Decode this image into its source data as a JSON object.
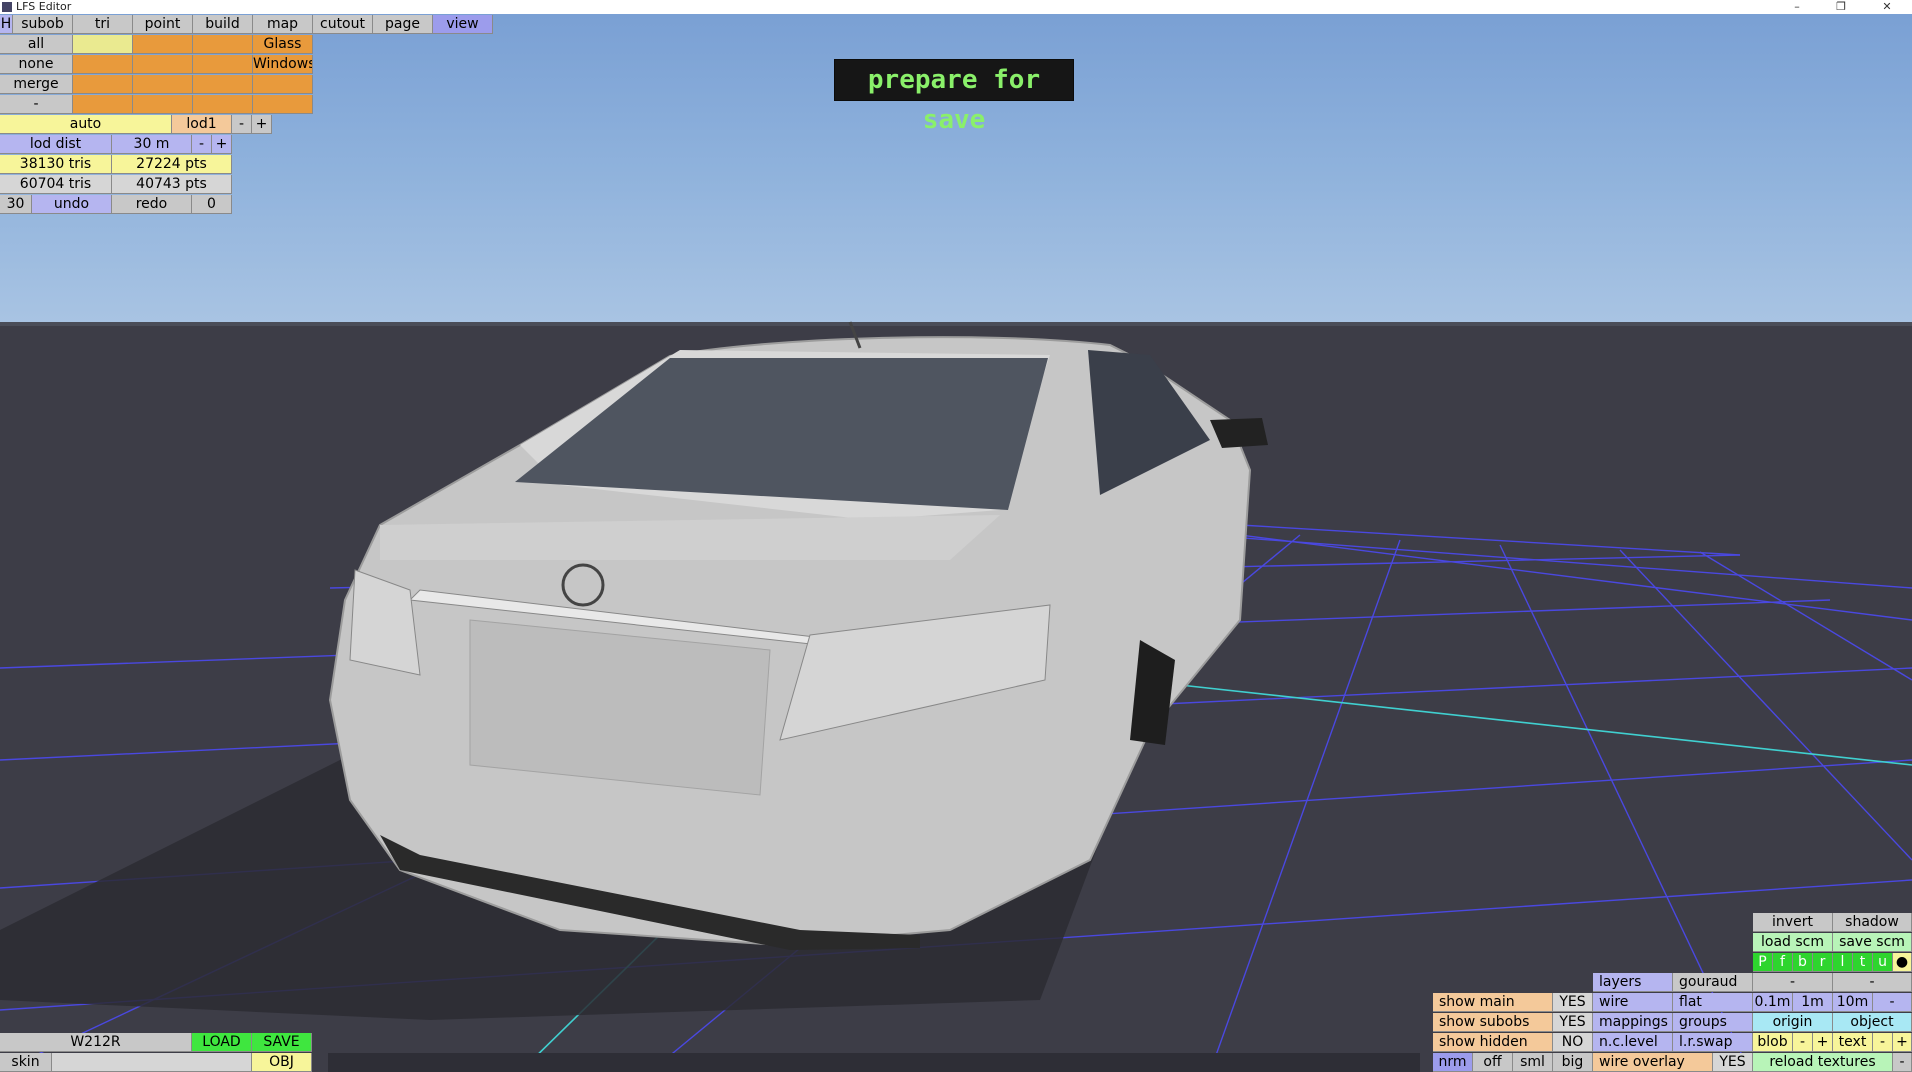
{
  "window": {
    "title": "LFS Editor",
    "controls": [
      "–",
      "❐",
      "✕"
    ]
  },
  "menu": {
    "items": [
      "H",
      "subob",
      "tri",
      "point",
      "build",
      "map",
      "cutout",
      "page",
      "view"
    ]
  },
  "selection": {
    "rows": [
      {
        "label": "all",
        "slot": "Glass"
      },
      {
        "label": "none",
        "slot": "Windows"
      },
      {
        "label": "merge",
        "slot": ""
      },
      {
        "label": "-",
        "slot": ""
      }
    ]
  },
  "lod": {
    "auto": "auto",
    "level": "lod1",
    "minus": "-",
    "plus": "+",
    "dist_label": "lod dist",
    "dist_value": "30 m"
  },
  "stats": {
    "row1_tris": "38130 tris",
    "row1_pts": "27224 pts",
    "row2_tris": "60704 tris",
    "row2_pts": "40743 pts"
  },
  "history": {
    "undo_count": "30",
    "undo": "undo",
    "redo": "redo",
    "redo_count": "0"
  },
  "banner": {
    "text": "prepare for save"
  },
  "file": {
    "name": "W212R",
    "load": "LOAD",
    "save": "SAVE",
    "skin": "skin",
    "obj": "OBJ"
  },
  "display": {
    "show_main": "show main",
    "show_main_val": "YES",
    "show_subobs": "show subobs",
    "show_subobs_val": "YES",
    "show_hidden": "show hidden",
    "show_hidden_val": "NO",
    "nrm": "nrm",
    "off": "off",
    "sml": "sml",
    "big": "big"
  },
  "render": {
    "layers": "layers",
    "gouraud": "gouraud",
    "wire": "wire",
    "flat": "flat",
    "mappings": "mappings",
    "groups": "groups",
    "nclevel": "n.c.level",
    "lrswap": "l.r.swap",
    "wire_overlay": "wire overlay",
    "wire_overlay_val": "YES"
  },
  "tools": {
    "invert": "invert",
    "shadow": "shadow",
    "load_scm": "load scm",
    "save_scm": "save scm",
    "views": [
      "P",
      "f",
      "b",
      "r",
      "l",
      "t",
      "u",
      "●"
    ],
    "dash1": "-",
    "dash2": "-",
    "grid": [
      "0.1m",
      "1m",
      "10m",
      "-"
    ],
    "origin": "origin",
    "object": "object",
    "blob": "blob",
    "blob_minus": "-",
    "blob_plus": "+",
    "text": "text",
    "text_minus": "-",
    "text_plus": "+",
    "reload": "reload textures",
    "reload_minus": "-"
  },
  "colors": {
    "sky_top": "#7aa0d4",
    "ground": "#3d3d47",
    "grid": "#4a48e0",
    "banner_text": "#8af06a"
  }
}
